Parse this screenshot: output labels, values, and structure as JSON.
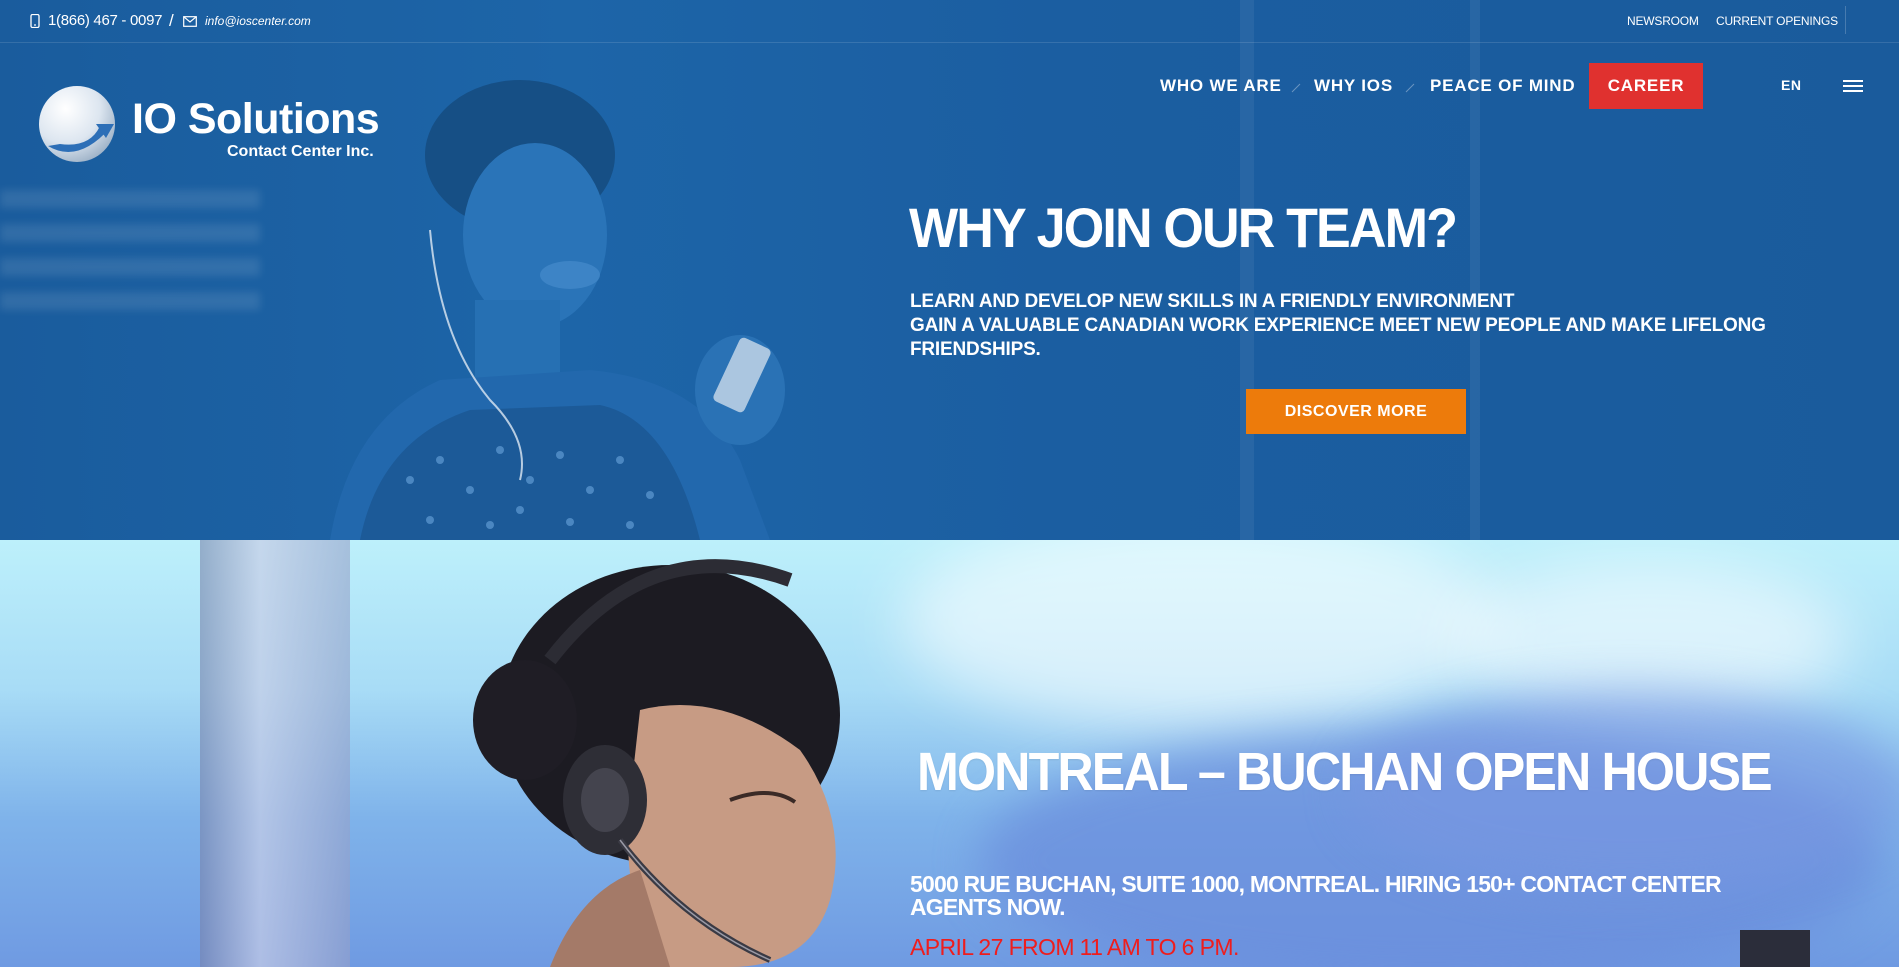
{
  "topbar": {
    "phone": "1(866) 467 - 0097",
    "separator": "/",
    "email": "info@ioscenter.com",
    "links": [
      "NEWSROOM",
      "CURRENT OPENINGS"
    ]
  },
  "logo": {
    "title": "IO Solutions",
    "subtitle": "Contact Center Inc."
  },
  "nav": {
    "items": [
      "WHO WE ARE",
      "WHY IOS",
      "PEACE OF MIND"
    ],
    "career": "CAREER",
    "language": "EN"
  },
  "hero1": {
    "heading": "WHY JOIN OUR TEAM?",
    "lines": [
      "LEARN AND DEVELOP NEW SKILLS IN A FRIENDLY ENVIRONMENT",
      "GAIN A VALUABLE CANADIAN WORK EXPERIENCE MEET NEW PEOPLE AND MAKE LIFELONG FRIENDSHIPS."
    ],
    "button": "DISCOVER MORE"
  },
  "hero2": {
    "heading": "MONTREAL – BUCHAN OPEN HOUSE",
    "description": "5000 RUE BUCHAN, SUITE 1000, MONTREAL. HIRING 150+ CONTACT CENTER AGENTS NOW.",
    "date": "APRIL 27 FROM 11 AM TO 6 PM."
  },
  "colors": {
    "hero_blue": "#1a5c9c",
    "career_red": "#e0312f",
    "discover_orange": "#ed7b0b",
    "date_red": "#ef1d1d"
  }
}
